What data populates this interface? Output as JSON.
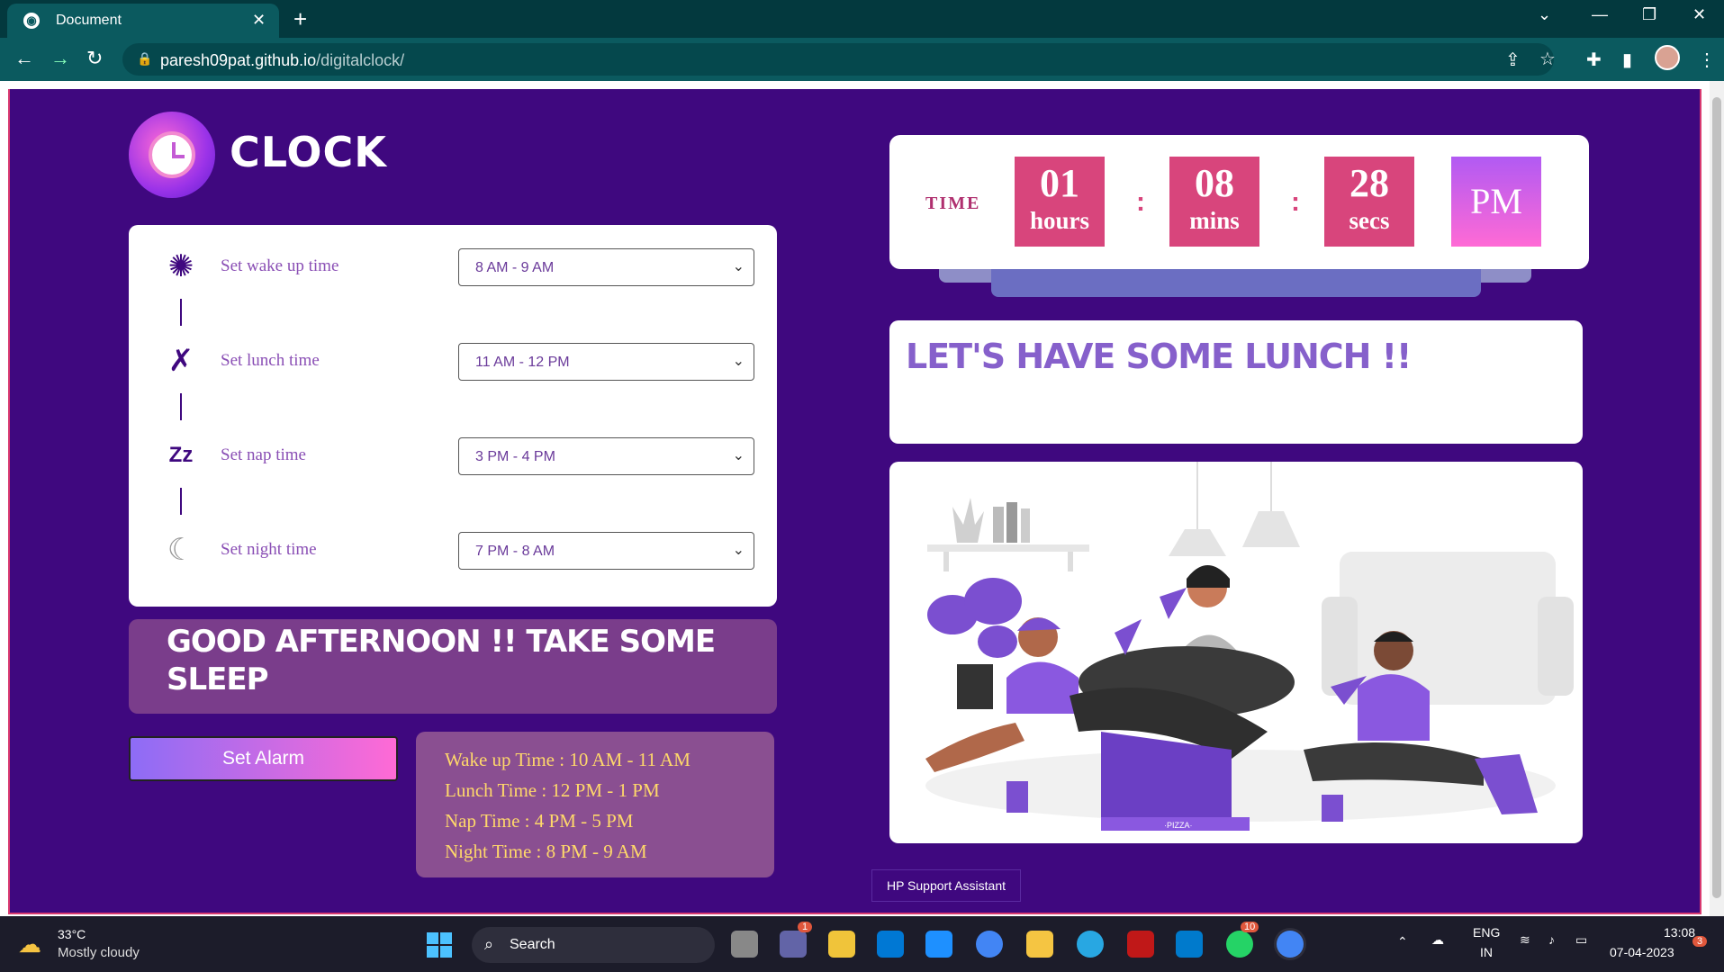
{
  "browser": {
    "tab_title": "Document",
    "url_host": "paresh09pat.github.io",
    "url_path": "/digitalclock/"
  },
  "logo": {
    "text": "CLOCK"
  },
  "schedule": {
    "rows": [
      {
        "label": "Set wake up time",
        "value": "8 AM - 9 AM",
        "icon": "sun-icon"
      },
      {
        "label": "Set lunch time",
        "value": "11 AM - 12 PM",
        "icon": "fork-spoon-icon"
      },
      {
        "label": "Set nap time",
        "value": "3 PM - 4 PM",
        "icon": "zzz-icon"
      },
      {
        "label": "Set night time",
        "value": "7 PM - 8 AM",
        "icon": "moon-icon"
      }
    ]
  },
  "greeting": "GOOD AFTERNOON !! TAKE SOME SLEEP",
  "alarm_button": "Set Alarm",
  "summary": {
    "wake": "Wake up Time : 10 AM - 11 AM",
    "lunch": "Lunch Time : 12 PM - 1 PM",
    "nap": "Nap Time : 4 PM - 5 PM",
    "night": "Night Time : 8 PM - 9 AM"
  },
  "clock": {
    "label": "TIME",
    "hours": "01",
    "hours_unit": "hours",
    "mins": "08",
    "mins_unit": "mins",
    "secs": "28",
    "secs_unit": "secs",
    "ampm": "PM"
  },
  "message": "LET'S HAVE SOME LUNCH !!",
  "illustration": {
    "pizza_box_text": "·PIZZA·"
  },
  "tooltip": "HP Support Assistant",
  "taskbar": {
    "temp": "33°C",
    "weather": "Mostly cloudy",
    "search": "Search",
    "lang1": "ENG",
    "lang2": "IN",
    "time": "13:08",
    "date": "07-04-2023",
    "teams_badge": "1",
    "whatsapp_badge": "10",
    "notif_badge": "3"
  },
  "colors": {
    "page_bg": "#3f087f",
    "accent_pink": "#d8457c",
    "summary_text": "#ffd86a"
  }
}
